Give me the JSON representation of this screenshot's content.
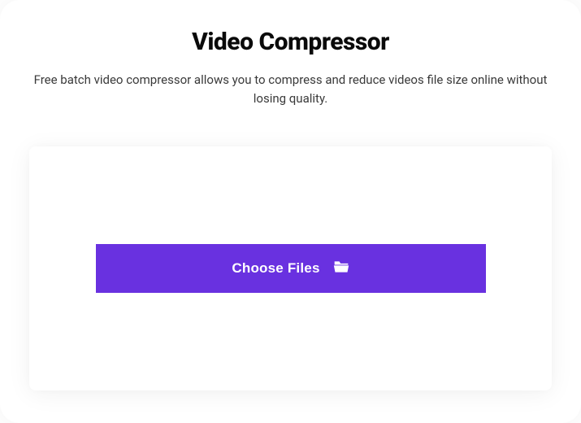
{
  "header": {
    "title": "Video Compressor",
    "subtitle": "Free batch video compressor allows you to compress and reduce videos file size online without losing quality."
  },
  "upload": {
    "choose_label": "Choose Files"
  }
}
